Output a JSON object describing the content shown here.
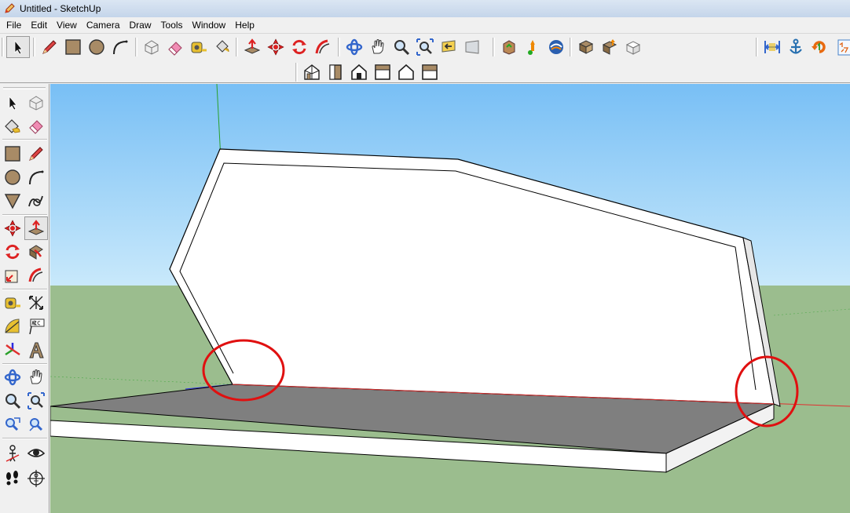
{
  "window": {
    "title": "Untitled - SketchUp",
    "app_icon": "sketchup-pencil-icon"
  },
  "menu": [
    "File",
    "Edit",
    "View",
    "Camera",
    "Draw",
    "Tools",
    "Window",
    "Help"
  ],
  "toolbar_row1": [
    {
      "name": "select-tool-icon"
    },
    {
      "name": "line-tool-icon"
    },
    {
      "name": "rectangle-tool-icon"
    },
    {
      "name": "circle-tool-icon"
    },
    {
      "name": "arc-tool-icon"
    },
    {
      "name": "make-component-icon"
    },
    {
      "name": "eraser-icon"
    },
    {
      "name": "tape-measure-icon"
    },
    {
      "name": "paint-bucket-icon"
    },
    {
      "name": "push-pull-icon"
    },
    {
      "name": "move-icon"
    },
    {
      "name": "rotate-icon"
    },
    {
      "name": "follow-me-icon"
    },
    {
      "name": "orbit-icon"
    },
    {
      "name": "pan-icon"
    },
    {
      "name": "zoom-icon"
    },
    {
      "name": "zoom-extents-icon"
    },
    {
      "name": "previous-view-icon"
    },
    {
      "name": "next-view-icon"
    },
    {
      "name": "get-models-icon"
    },
    {
      "name": "share-model-icon"
    },
    {
      "name": "google-earth-icon"
    },
    {
      "name": "get-current-view-icon"
    },
    {
      "name": "share-component-icon"
    },
    {
      "name": "toggle-terrain-icon"
    },
    {
      "name": "dimension-icon"
    },
    {
      "name": "sandbox-icon"
    },
    {
      "name": "refresh-icon"
    },
    {
      "name": "section-icon"
    }
  ],
  "toolbar_row2": [
    {
      "name": "iso-view-icon"
    },
    {
      "name": "top-view-icon"
    },
    {
      "name": "front-view-icon"
    },
    {
      "name": "right-view-icon"
    },
    {
      "name": "back-view-icon"
    },
    {
      "name": "left-view-icon"
    }
  ],
  "left_palette": [
    "select-icon",
    "make-component-icon",
    "paint-bucket-icon",
    "eraser-icon",
    "rectangle-icon",
    "line-icon",
    "circle-icon",
    "arc-icon",
    "polygon-icon",
    "freehand-icon",
    "move-icon",
    "push-pull-icon",
    "rotate-icon",
    "follow-me-icon",
    "scale-icon",
    "offset-icon",
    "tape-measure-icon",
    "dimension-icon",
    "protractor-icon",
    "text-icon",
    "axes-icon",
    "3d-text-icon",
    "orbit-icon",
    "pan-icon",
    "zoom-icon",
    "zoom-window-icon",
    "previous-view-icon",
    "zoom-extents-icon",
    "position-camera-icon",
    "look-around-icon",
    "walk-icon",
    "section-plane-icon"
  ],
  "colors": {
    "sky_top": "#78bff5",
    "sky_bottom": "#c9e9fb",
    "ground": "#9bbd8e",
    "face_white": "#ffffff",
    "face_shaded": "#7f7f7f",
    "axis_red": "#e03030",
    "axis_green": "#2aa02a",
    "axis_blue": "#2a2ae0",
    "highlight_circle": "#e01010"
  }
}
